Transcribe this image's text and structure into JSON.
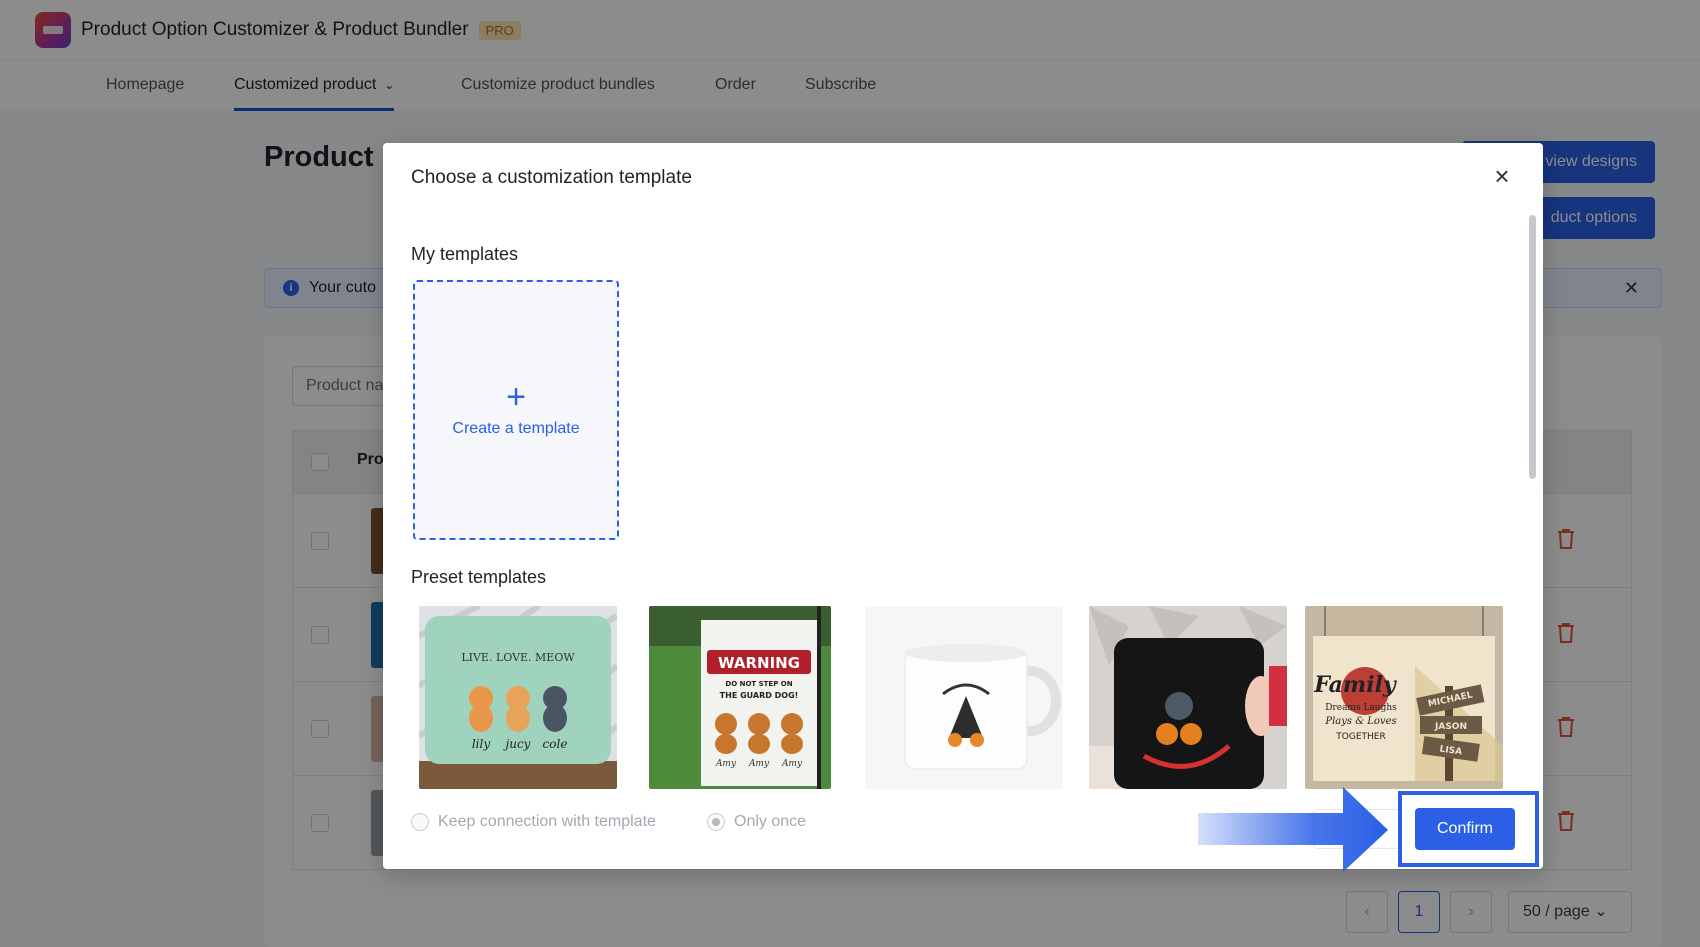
{
  "app": {
    "title": "Product Option Customizer & Product Bundler",
    "badge": "PRO"
  },
  "nav": {
    "items": [
      {
        "label": "Homepage"
      },
      {
        "label": "Customized product",
        "active": true
      },
      {
        "label": "Customize product bundles"
      },
      {
        "label": "Order"
      },
      {
        "label": "Subscribe"
      }
    ]
  },
  "background": {
    "page_title": "Product l",
    "btn_view_designs": "view designs",
    "btn_product_options": "duct options",
    "info_text": "Your cuto",
    "search_placeholder": "Product na",
    "table_header_product": "Pro",
    "pagination": {
      "prev": "‹",
      "current": "1",
      "next": "›",
      "page_size": "50 / page"
    }
  },
  "modal": {
    "title": "Choose a customization template",
    "my_templates_title": "My templates",
    "create_template_label": "Create a template",
    "preset_templates_title": "Preset templates",
    "presets": [
      {
        "name": "Pillow",
        "text_lines": [
          "LIVE. LOVE. MEOW"
        ],
        "names": [
          "lily",
          "jucy",
          "cole"
        ]
      },
      {
        "name": "Garden flag",
        "text_lines": [
          "WARNING",
          "DO NOT STEP ON",
          "THE GUARD DOG!"
        ],
        "names": [
          "Amy",
          "Amy",
          "Amy"
        ]
      },
      {
        "name": "White mug"
      },
      {
        "name": "Black mug"
      },
      {
        "name": "Family sign",
        "text_lines": [
          "Family",
          "Dreams Laughs",
          "Plays & Loves",
          "TOGETHER"
        ],
        "names": [
          "MICHAEL",
          "JASON",
          "LISA"
        ]
      }
    ],
    "options": {
      "keep_connection": "Keep connection with template",
      "only_once": "Only once"
    },
    "confirm_label": "Confirm"
  },
  "colors": {
    "primary": "#2a5fe6",
    "overlay": "rgba(0,0,0,0.45)",
    "danger": "#e2553b"
  }
}
